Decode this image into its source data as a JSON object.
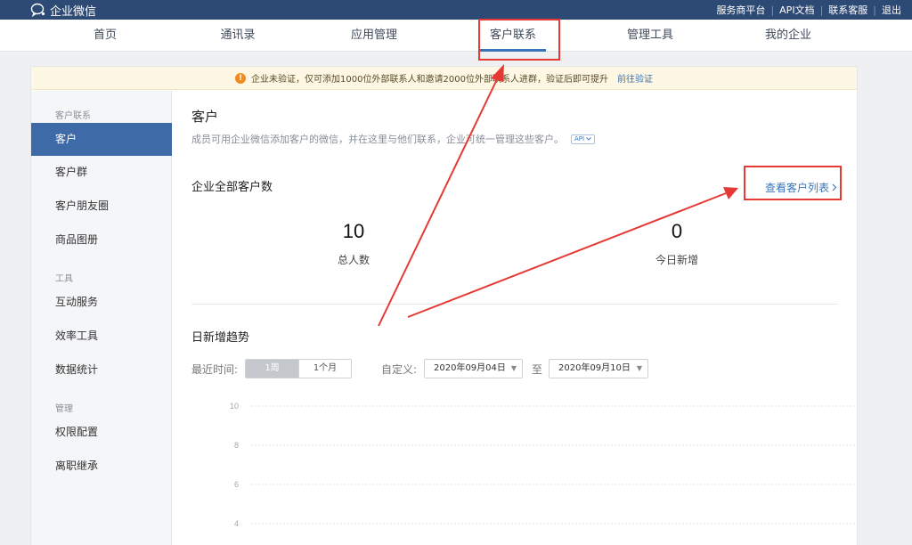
{
  "topbar": {
    "brand": "企业微信",
    "links": [
      "服务商平台",
      "API文档",
      "联系客服",
      "退出"
    ]
  },
  "nav": {
    "items": [
      "首页",
      "通讯录",
      "应用管理",
      "客户联系",
      "管理工具",
      "我的企业"
    ],
    "active_index": 3
  },
  "notice": {
    "text": "企业未验证，仅可添加1000位外部联系人和邀请2000位外部联系人进群，验证后即可提升",
    "link": "前往验证"
  },
  "sidebar": {
    "groups": [
      {
        "label": "客户联系",
        "items": [
          "客户",
          "客户群",
          "客户朋友圈",
          "商品图册"
        ]
      },
      {
        "label": "工具",
        "items": [
          "互动服务",
          "效率工具",
          "数据统计"
        ]
      },
      {
        "label": "管理",
        "items": [
          "权限配置",
          "离职继承"
        ]
      }
    ],
    "active_item": "客户"
  },
  "main": {
    "title": "客户",
    "description": "成员可用企业微信添加客户的微信，并在这里与他们联系，企业可统一管理这些客户。",
    "api_badge": "API",
    "total_section": "企业全部客户数",
    "view_list": "查看客户列表",
    "stats": [
      {
        "value": "10",
        "label": "总人数"
      },
      {
        "value": "0",
        "label": "今日新增"
      }
    ],
    "trend": {
      "title": "日新增趋势",
      "recent_label": "最近时间:",
      "ranges": [
        "1周",
        "1个月"
      ],
      "active_range": "1周",
      "custom_label": "自定义:",
      "start_date": "2020年09月04日",
      "to_label": "至",
      "end_date": "2020年09月10日"
    }
  },
  "chart_data": {
    "type": "line",
    "y_ticks": [
      "10",
      "8",
      "6",
      "4"
    ],
    "ylim": [
      4,
      10
    ],
    "grid": true
  },
  "colors": {
    "topbar": "#2d4a74",
    "accent": "#3a74b8",
    "active_sidebar": "#3e6aa7",
    "annotation": "#e53935"
  }
}
